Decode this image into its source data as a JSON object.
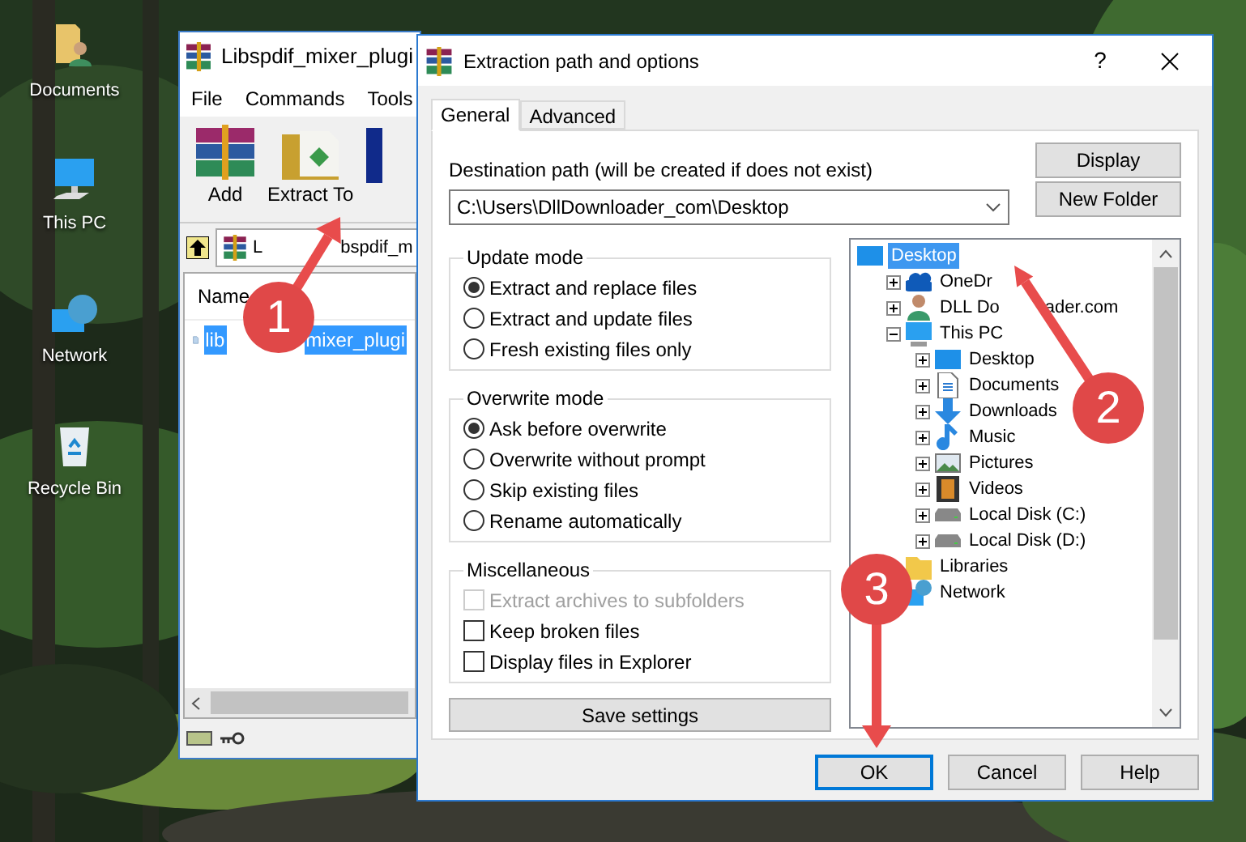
{
  "desktop_icons": [
    {
      "label": "Documents",
      "kind": "documents"
    },
    {
      "label": "This PC",
      "kind": "computer"
    },
    {
      "label": "Network",
      "kind": "network"
    },
    {
      "label": "Recycle Bin",
      "kind": "recycle"
    }
  ],
  "archive_window": {
    "title": "Libspdif_mixer_plugi",
    "menu": [
      "File",
      "Commands",
      "Tools"
    ],
    "toolbar": [
      {
        "label": "Add",
        "kind": "add"
      },
      {
        "label": "Extract To",
        "kind": "extract"
      }
    ],
    "path_parts": [
      "L",
      "bspdif_m"
    ],
    "column": "Name",
    "files": [
      {
        "name_parts": [
          "lib",
          "mixer_plugi"
        ],
        "selected": true
      }
    ]
  },
  "dialog": {
    "title": "Extraction path and options",
    "help": "?",
    "tabs": [
      {
        "label": "General",
        "selected": true
      },
      {
        "label": "Advanced",
        "selected": false
      }
    ],
    "destination_label": "Destination path (will be created if does not exist)",
    "destination_path": "C:\\Users\\DllDownloader_com\\Desktop",
    "side_buttons": [
      "Display",
      "New Folder"
    ],
    "groups": [
      {
        "title": "Update mode",
        "options": [
          {
            "kind": "radio",
            "label": "Extract and replace files",
            "selected": true
          },
          {
            "kind": "radio",
            "label": "Extract and update files",
            "selected": false
          },
          {
            "kind": "radio",
            "label": "Fresh existing files only",
            "selected": false
          }
        ]
      },
      {
        "title": "Overwrite mode",
        "options": [
          {
            "kind": "radio",
            "label": "Ask before overwrite",
            "selected": true
          },
          {
            "kind": "radio",
            "label": "Overwrite without prompt",
            "selected": false
          },
          {
            "kind": "radio",
            "label": "Skip existing files",
            "selected": false
          },
          {
            "kind": "radio",
            "label": "Rename automatically",
            "selected": false
          }
        ]
      },
      {
        "title": "Miscellaneous",
        "options": [
          {
            "kind": "checkbox",
            "label": "Extract archives to subfolders",
            "checked": false,
            "disabled": true
          },
          {
            "kind": "checkbox",
            "label": "Keep broken files",
            "checked": false,
            "disabled": false
          },
          {
            "kind": "checkbox",
            "label": "Display files in Explorer",
            "checked": false,
            "disabled": false
          }
        ]
      }
    ],
    "save_button": "Save settings",
    "tree": [
      {
        "label_parts": [
          "Desktop"
        ],
        "kind": "desktop",
        "selected": true,
        "children": [
          {
            "label_parts": [
              "OneDr"
            ],
            "kind": "cloud",
            "selected": false,
            "expanded": false
          },
          {
            "label_parts": [
              "DLL Do",
              "ader.com"
            ],
            "kind": "user",
            "selected": false,
            "expanded": false
          },
          {
            "label_parts": [
              "This PC"
            ],
            "kind": "computer",
            "selected": false,
            "expanded": true,
            "children": [
              {
                "label_parts": [
                  "Desktop"
                ],
                "kind": "desktop",
                "selected": false,
                "expanded": false
              },
              {
                "label_parts": [
                  "Documents"
                ],
                "kind": "document",
                "selected": false,
                "expanded": false
              },
              {
                "label_parts": [
                  "Downloads"
                ],
                "kind": "download",
                "selected": false,
                "expanded": false
              },
              {
                "label_parts": [
                  "Music"
                ],
                "kind": "music",
                "selected": false,
                "expanded": false
              },
              {
                "label_parts": [
                  "Pictures"
                ],
                "kind": "picture",
                "selected": false,
                "expanded": false
              },
              {
                "label_parts": [
                  "Videos"
                ],
                "kind": "video",
                "selected": false,
                "expanded": false
              },
              {
                "label_parts": [
                  "Local Disk (C:)"
                ],
                "kind": "disk",
                "selected": false,
                "expanded": false
              },
              {
                "label_parts": [
                  "Local Disk (D:)"
                ],
                "kind": "disk",
                "selected": false,
                "expanded": false
              }
            ]
          },
          {
            "label_parts": [
              "Libraries"
            ],
            "kind": "library",
            "selected": false
          },
          {
            "label_parts": [
              "Network"
            ],
            "kind": "network",
            "selected": false
          }
        ]
      }
    ],
    "buttons": [
      {
        "label": "OK",
        "default": true
      },
      {
        "label": "Cancel",
        "default": false
      },
      {
        "label": "Help",
        "default": false
      }
    ]
  },
  "annotations": [
    {
      "number": "1"
    },
    {
      "number": "2"
    },
    {
      "number": "3"
    }
  ]
}
